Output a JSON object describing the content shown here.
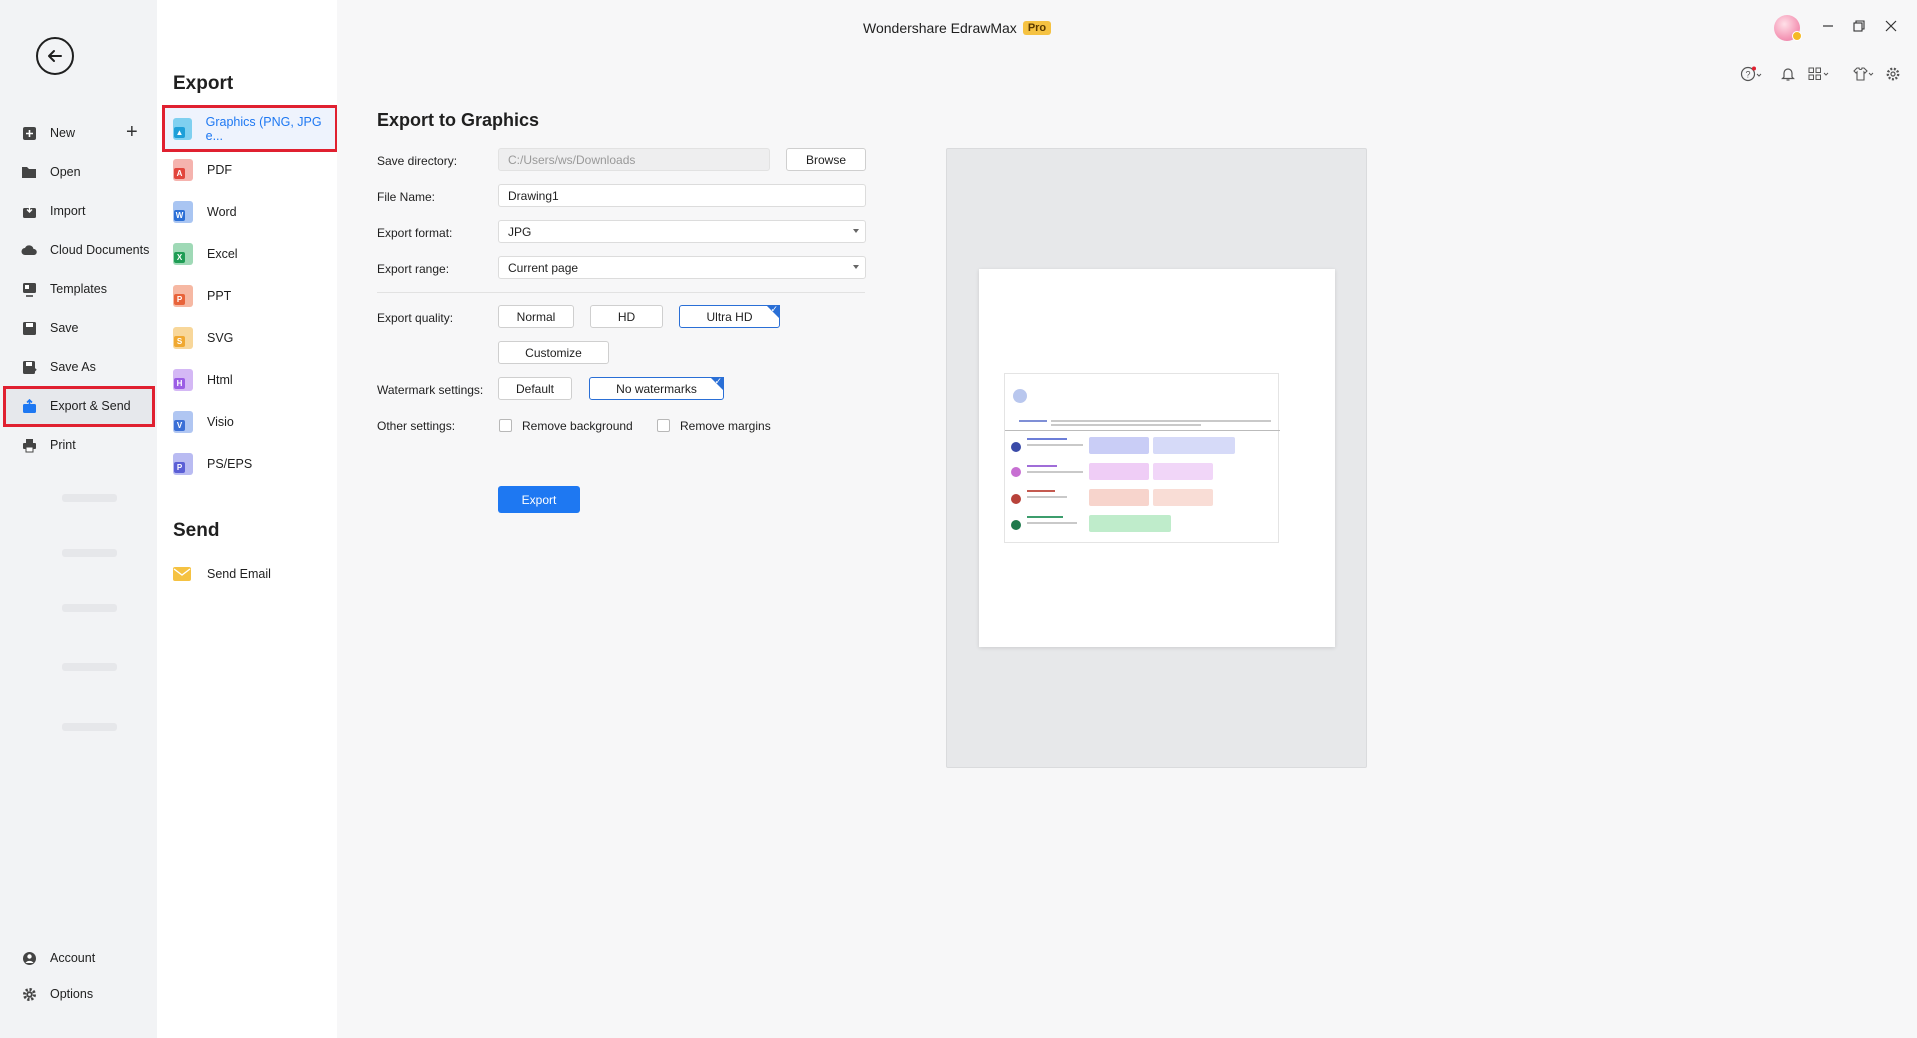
{
  "app": {
    "title": "Wondershare EdrawMax",
    "badge": "Pro"
  },
  "nav": {
    "back_label": "Back",
    "new": "New",
    "open": "Open",
    "import": "Import",
    "cloud": "Cloud Documents",
    "templates": "Templates",
    "save": "Save",
    "save_as": "Save As",
    "export_send": "Export & Send",
    "print": "Print",
    "account": "Account",
    "options": "Options"
  },
  "export_list": {
    "export_title": "Export",
    "items": [
      {
        "label": "Graphics (PNG, JPG e...",
        "color": "#29a9e0"
      },
      {
        "label": "PDF",
        "color": "#e2453c"
      },
      {
        "label": "Word",
        "color": "#2b6fd6"
      },
      {
        "label": "Excel",
        "color": "#1f9d55"
      },
      {
        "label": "PPT",
        "color": "#e8633a"
      },
      {
        "label": "SVG",
        "color": "#f0a830"
      },
      {
        "label": "Html",
        "color": "#9b5de5"
      },
      {
        "label": "Visio",
        "color": "#3b6fd6"
      },
      {
        "label": "PS/EPS",
        "color": "#5b5fd6"
      }
    ],
    "send_title": "Send",
    "send_email": "Send Email"
  },
  "panel": {
    "title": "Export to Graphics",
    "save_directory_label": "Save directory:",
    "save_directory_value": "C:/Users/ws/Downloads",
    "browse": "Browse",
    "file_name_label": "File Name:",
    "file_name_value": "Drawing1",
    "export_format_label": "Export format:",
    "export_format_value": "JPG",
    "export_range_label": "Export range:",
    "export_range_value": "Current page",
    "export_quality_label": "Export quality:",
    "quality_normal": "Normal",
    "quality_hd": "HD",
    "quality_ultra_hd": "Ultra HD",
    "customize": "Customize",
    "watermark_label": "Watermark settings:",
    "watermark_default": "Default",
    "watermark_none": "No watermarks",
    "other_label": "Other settings:",
    "remove_background": "Remove background",
    "remove_margins": "Remove margins",
    "export_button": "Export"
  },
  "colors": {
    "accent": "#1e78f2",
    "highlight": "#e02030"
  }
}
